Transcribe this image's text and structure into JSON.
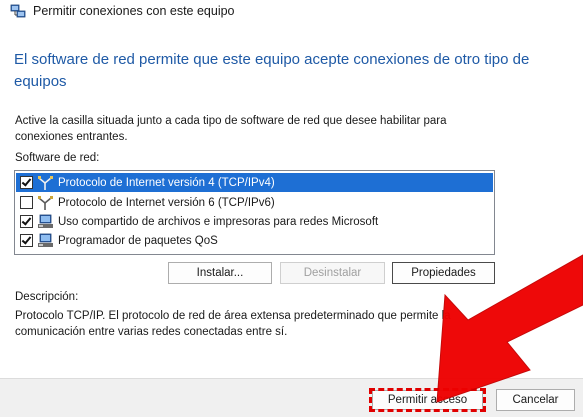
{
  "window": {
    "title": "Permitir conexiones con este equipo"
  },
  "heading": "El software de red permite que este equipo acepte conexiones de otro tipo de equipos",
  "instructions": "Active la casilla situada junto a cada tipo de software de red que desee habilitar para conexiones entrantes.",
  "software": {
    "label": "Software de red:",
    "items": [
      {
        "label": "Protocolo de Internet versión 4 (TCP/IPv4)",
        "checked": true,
        "selected": true,
        "icon": "network-protocol-icon"
      },
      {
        "label": "Protocolo de Internet versión 6 (TCP/IPv6)",
        "checked": false,
        "selected": false,
        "icon": "network-protocol-icon"
      },
      {
        "label": "Uso compartido de archivos e impresoras para redes Microsoft",
        "checked": true,
        "selected": false,
        "icon": "network-service-icon"
      },
      {
        "label": "Programador de paquetes QoS",
        "checked": true,
        "selected": false,
        "icon": "network-service-icon"
      }
    ]
  },
  "buttons": {
    "install": "Instalar...",
    "uninstall": "Desinstalar",
    "properties": "Propiedades",
    "allow": "Permitir acceso",
    "cancel": "Cancelar"
  },
  "description": {
    "label": "Descripción:",
    "text": "Protocolo TCP/IP. El protocolo de red de área extensa predeterminado que permite la comunicación entre varias redes conectadas entre sí."
  },
  "colors": {
    "heading": "#1f5aa6",
    "selection": "#1e6fd4",
    "annotation": "#e00000"
  }
}
